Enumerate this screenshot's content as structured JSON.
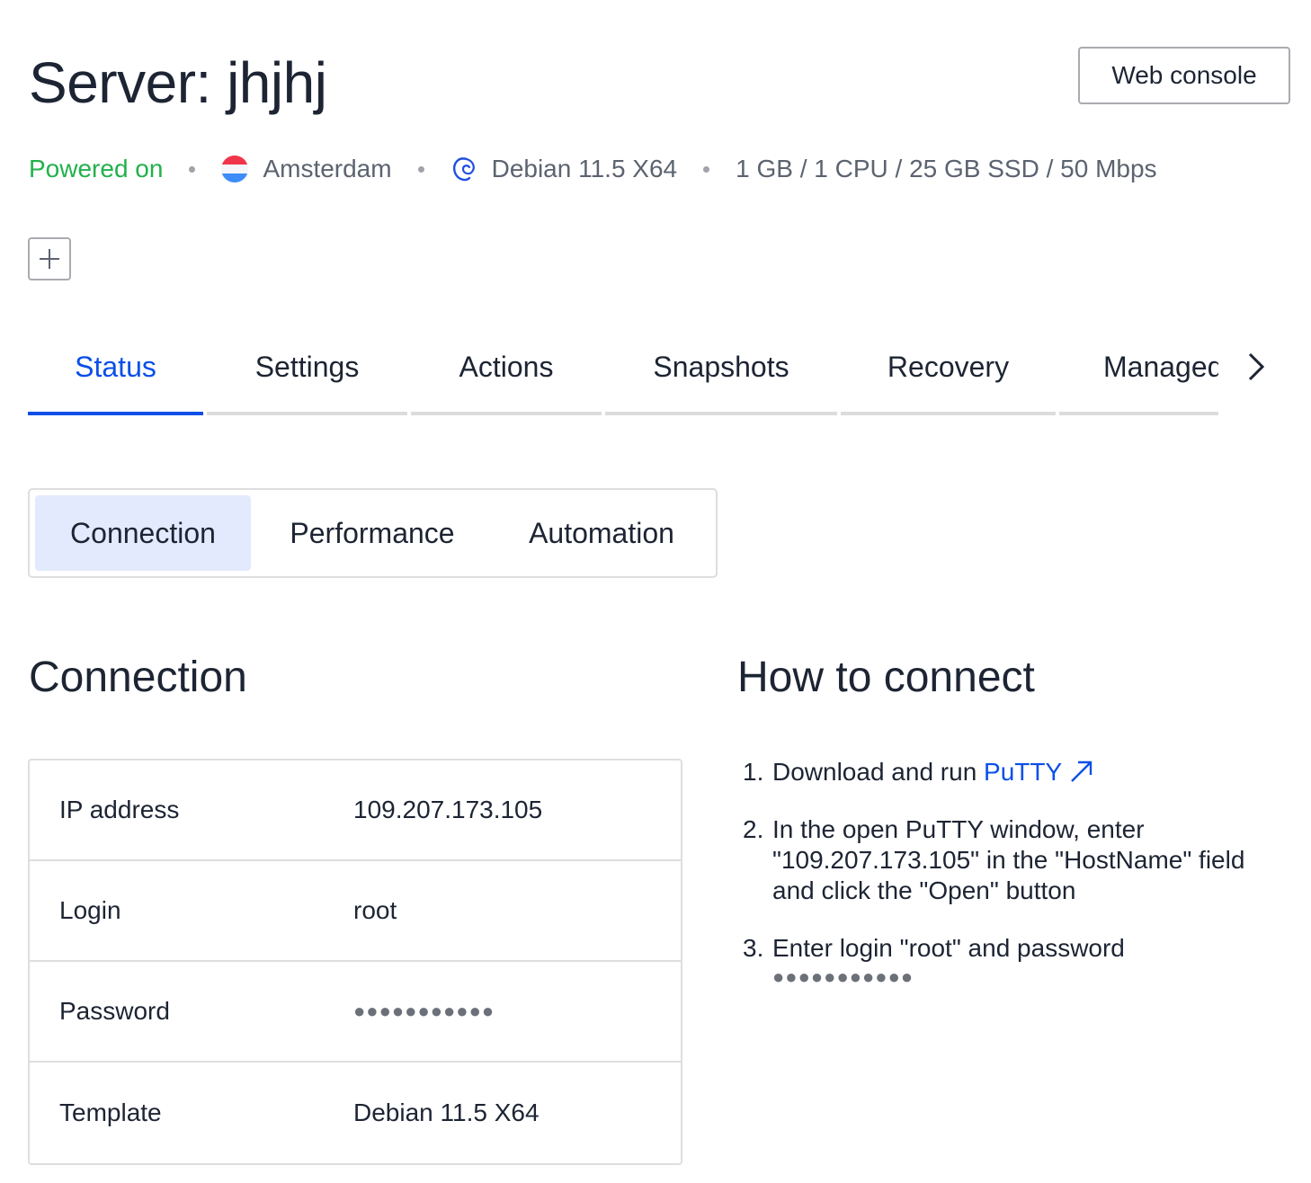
{
  "header": {
    "title": "Server: jhjhj",
    "web_console_label": "Web console"
  },
  "meta": {
    "status": "Powered on",
    "status_color": "#22b14c",
    "location": "Amsterdam",
    "location_icon": "netherlands-flag-icon",
    "os": "Debian 11.5 X64",
    "os_icon": "debian-swirl-icon",
    "specs": "1 GB / 1 CPU / 25 GB SSD / 50 Mbps"
  },
  "add_button": {
    "icon": "plus-icon"
  },
  "tabs": [
    {
      "label": "Status",
      "active": true
    },
    {
      "label": "Settings",
      "active": false
    },
    {
      "label": "Actions",
      "active": false
    },
    {
      "label": "Snapshots",
      "active": false
    },
    {
      "label": "Recovery",
      "active": false
    },
    {
      "label": "Managed",
      "active": false
    }
  ],
  "tabs_next_icon": "chevron-right-icon",
  "subtabs": [
    {
      "label": "Connection",
      "active": true
    },
    {
      "label": "Performance",
      "active": false
    },
    {
      "label": "Automation",
      "active": false
    }
  ],
  "connection": {
    "title": "Connection",
    "rows": [
      {
        "key": "IP address",
        "value": "109.207.173.105"
      },
      {
        "key": "Login",
        "value": "root"
      },
      {
        "key": "Password",
        "value": "●●●●●●●●●●●"
      },
      {
        "key": "Template",
        "value": "Debian 11.5 X64"
      }
    ]
  },
  "how_to": {
    "title": "How to connect",
    "steps": [
      {
        "num": "1.",
        "text": "Download and run ",
        "link": "PuTTY"
      },
      {
        "num": "2.",
        "text": "In the open PuTTY window, enter \"109.207.173.105\" in the \"HostName\" field and click the \"Open\" button"
      },
      {
        "num": "3.",
        "text": "Enter login \"root\" and password",
        "masked": "●●●●●●●●●●●"
      }
    ]
  },
  "colors": {
    "accent": "#0b4fe8",
    "text": "#1d2433",
    "muted": "#5c6370",
    "border": "#dedede",
    "selected_bg": "#e3eafd"
  }
}
